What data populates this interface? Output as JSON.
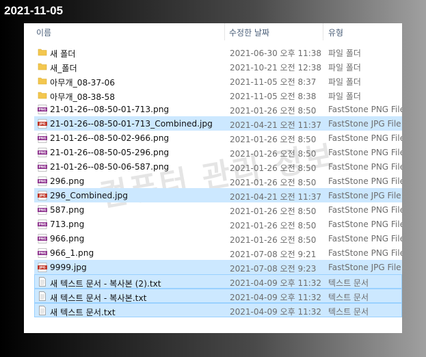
{
  "date_label": "2021-11-05",
  "header": {
    "name": "이름",
    "date": "수정한 날짜",
    "type": "유형"
  },
  "watermark": "컴퓨터 관리 정보",
  "rows": [
    {
      "name": "새 폴더",
      "date": "2021-06-30 오후 11:38",
      "type": "파일 폴더",
      "icon": "folder-icon",
      "state": ""
    },
    {
      "name": "새_폴더",
      "date": "2021-10-21 오전 12:38",
      "type": "파일 폴더",
      "icon": "folder-icon",
      "state": ""
    },
    {
      "name": "아무개_08-37-06",
      "date": "2021-11-05 오전 8:37",
      "type": "파일 폴더",
      "icon": "folder-icon",
      "state": ""
    },
    {
      "name": "아무개_08-38-58",
      "date": "2021-11-05 오전 8:38",
      "type": "파일 폴더",
      "icon": "folder-icon",
      "state": ""
    },
    {
      "name": "21-01-26--08-50-01-713.png",
      "date": "2021-01-26 오전 8:50",
      "type": "FastStone PNG File",
      "icon": "png-icon",
      "state": ""
    },
    {
      "name": "21-01-26--08-50-01-713_Combined.jpg",
      "date": "2021-04-21 오전 11:37",
      "type": "FastStone JPG File",
      "icon": "jpg-icon",
      "state": "sel"
    },
    {
      "name": "21-01-26--08-50-02-966.png",
      "date": "2021-01-26 오전 8:50",
      "type": "FastStone PNG File",
      "icon": "png-icon",
      "state": ""
    },
    {
      "name": "21-01-26--08-50-05-296.png",
      "date": "2021-01-26 오전 8:50",
      "type": "FastStone PNG File",
      "icon": "png-icon",
      "state": ""
    },
    {
      "name": "21-01-26--08-50-06-587.png",
      "date": "2021-01-26 오전 8:50",
      "type": "FastStone PNG File",
      "icon": "png-icon",
      "state": ""
    },
    {
      "name": "296.png",
      "date": "2021-01-26 오전 8:50",
      "type": "FastStone PNG File",
      "icon": "png-icon",
      "state": ""
    },
    {
      "name": "296_Combined.jpg",
      "date": "2021-04-21 오전 11:37",
      "type": "FastStone JPG File",
      "icon": "jpg-icon",
      "state": "sel"
    },
    {
      "name": "587.png",
      "date": "2021-01-26 오전 8:50",
      "type": "FastStone PNG File",
      "icon": "png-icon",
      "state": ""
    },
    {
      "name": "713.png",
      "date": "2021-01-26 오전 8:50",
      "type": "FastStone PNG File",
      "icon": "png-icon",
      "state": ""
    },
    {
      "name": "966.png",
      "date": "2021-01-26 오전 8:50",
      "type": "FastStone PNG File",
      "icon": "png-icon",
      "state": ""
    },
    {
      "name": "966_1.png",
      "date": "2021-07-08 오전 9:21",
      "type": "FastStone PNG File",
      "icon": "png-icon",
      "state": ""
    },
    {
      "name": "9999.jpg",
      "date": "2021-07-08 오전 9:23",
      "type": "FastStone JPG File",
      "icon": "jpg-icon",
      "state": "sel"
    },
    {
      "name": "새 텍스트 문서 - 복사본 (2).txt",
      "date": "2021-04-09 오후 11:32",
      "type": "텍스트 문서",
      "icon": "text-document-icon",
      "state": "sel-b"
    },
    {
      "name": "새 텍스트 문서 - 복사본.txt",
      "date": "2021-04-09 오후 11:32",
      "type": "텍스트 문서",
      "icon": "text-document-icon",
      "state": "sel-b"
    },
    {
      "name": "새 텍스트 문서.txt",
      "date": "2021-04-09 오후 11:32",
      "type": "텍스트 문서",
      "icon": "text-document-icon",
      "state": "sel-b"
    }
  ],
  "colors": {
    "selection": "#cce8ff",
    "selection_border": "#99d1ff",
    "folder": "#f3c74f",
    "png_badge": "#8b2d8b",
    "jpg_badge": "#c0392b"
  }
}
